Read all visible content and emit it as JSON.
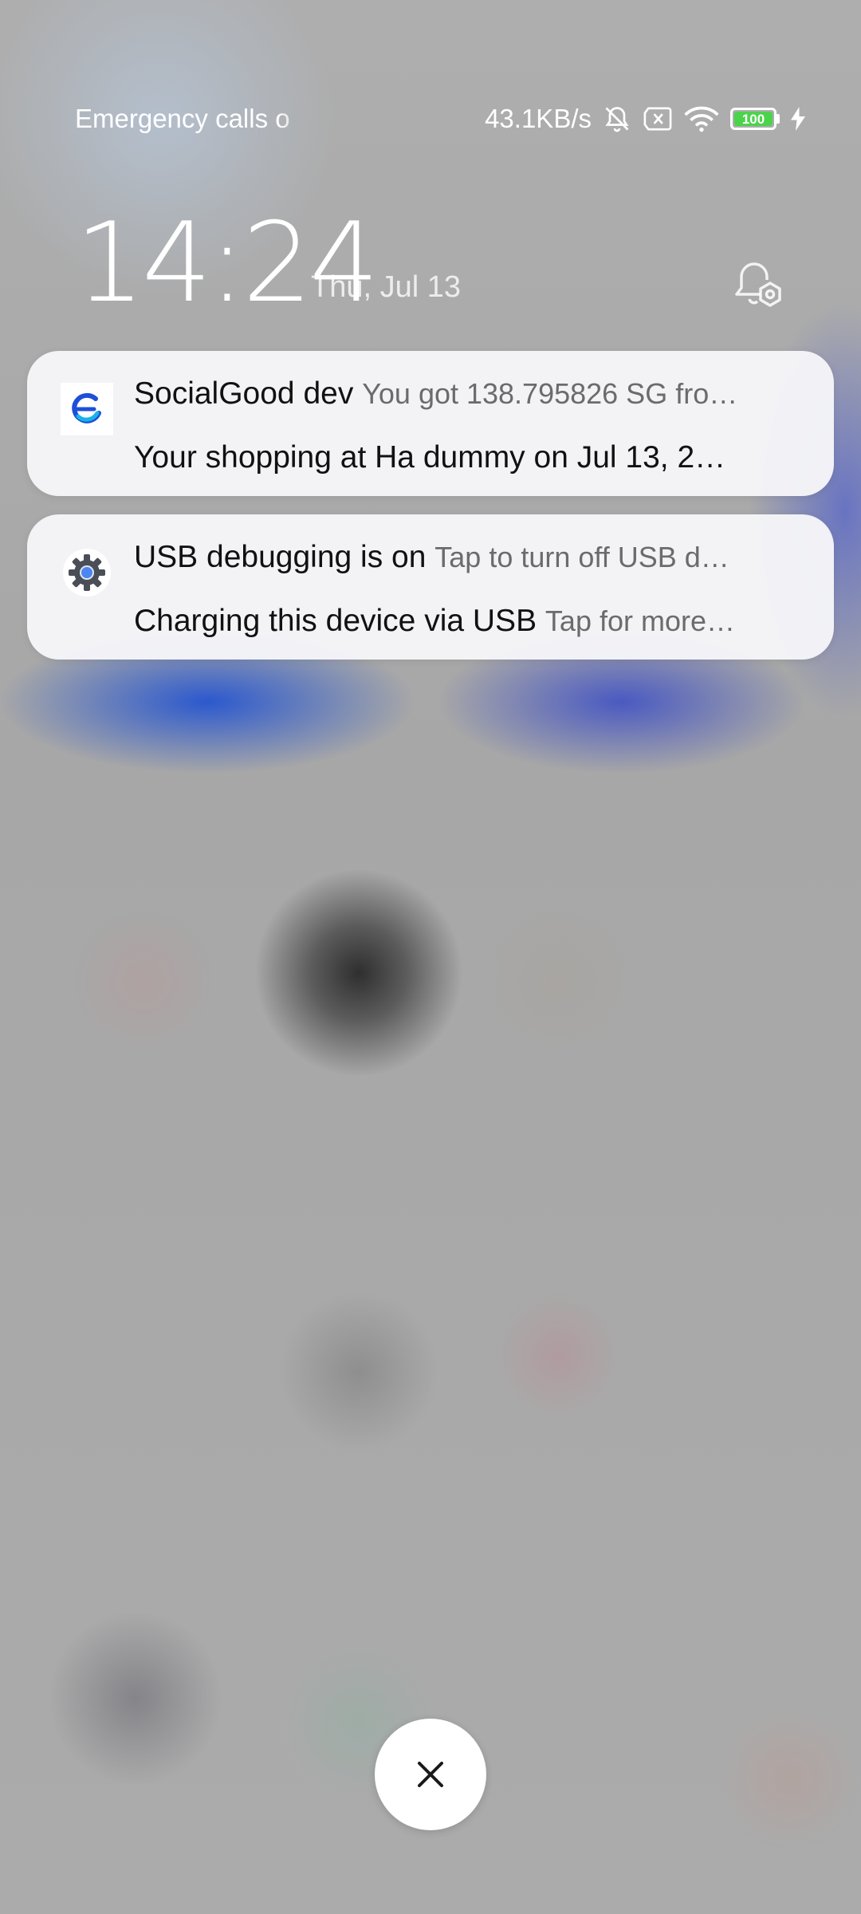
{
  "status_bar": {
    "carrier_text": "Emergency calls o",
    "network_speed": "43.1KB/s",
    "battery_level": "100",
    "icons": [
      "mute-bell-icon",
      "no-sim-icon",
      "wifi-icon",
      "battery-icon",
      "charging-bolt-icon"
    ]
  },
  "clock": {
    "time": "14:24",
    "date": "Thu, Jul 13"
  },
  "notifications": [
    {
      "icon": "socialgood-app-icon",
      "app_title": "SocialGood dev",
      "preview": "You got 138.795826 SG fro…",
      "detail": "Your shopping at Ha dummy on Jul 13, 2…"
    },
    {
      "icon": "settings-gear-icon",
      "title": "USB debugging is on",
      "preview": "Tap to turn off USB d…",
      "second_title": "Charging this device via USB",
      "second_preview": "Tap for more…"
    }
  ],
  "colors": {
    "battery_green": "#4cd34c",
    "socialgood_blue": "#1d4fd8",
    "socialgood_cyan": "#18b4e8"
  }
}
